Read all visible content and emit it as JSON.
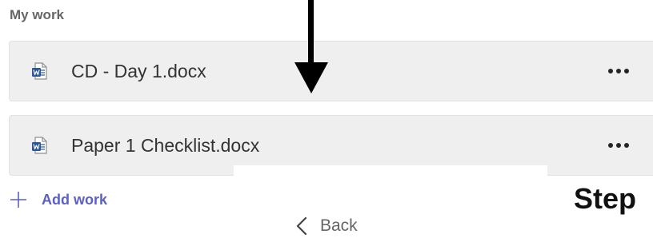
{
  "section": {
    "title": "My work"
  },
  "files": [
    {
      "name": "CD - Day 1.docx",
      "icon": "word-file-icon",
      "more_icon": "more-options-icon"
    },
    {
      "name": "Paper 1 Checklist.docx",
      "icon": "word-file-icon",
      "more_icon": "more-options-icon"
    }
  ],
  "actions": {
    "add_work_label": "Add work",
    "add_work_icon": "plus-icon",
    "back_label": "Back",
    "back_icon": "chevron-left-icon"
  },
  "annotation": {
    "step_label": "Step",
    "arrow_icon": "down-arrow-icon"
  },
  "colors": {
    "accent": "#5b5fc7",
    "word_blue": "#2b579a",
    "row_background": "#efefef"
  }
}
